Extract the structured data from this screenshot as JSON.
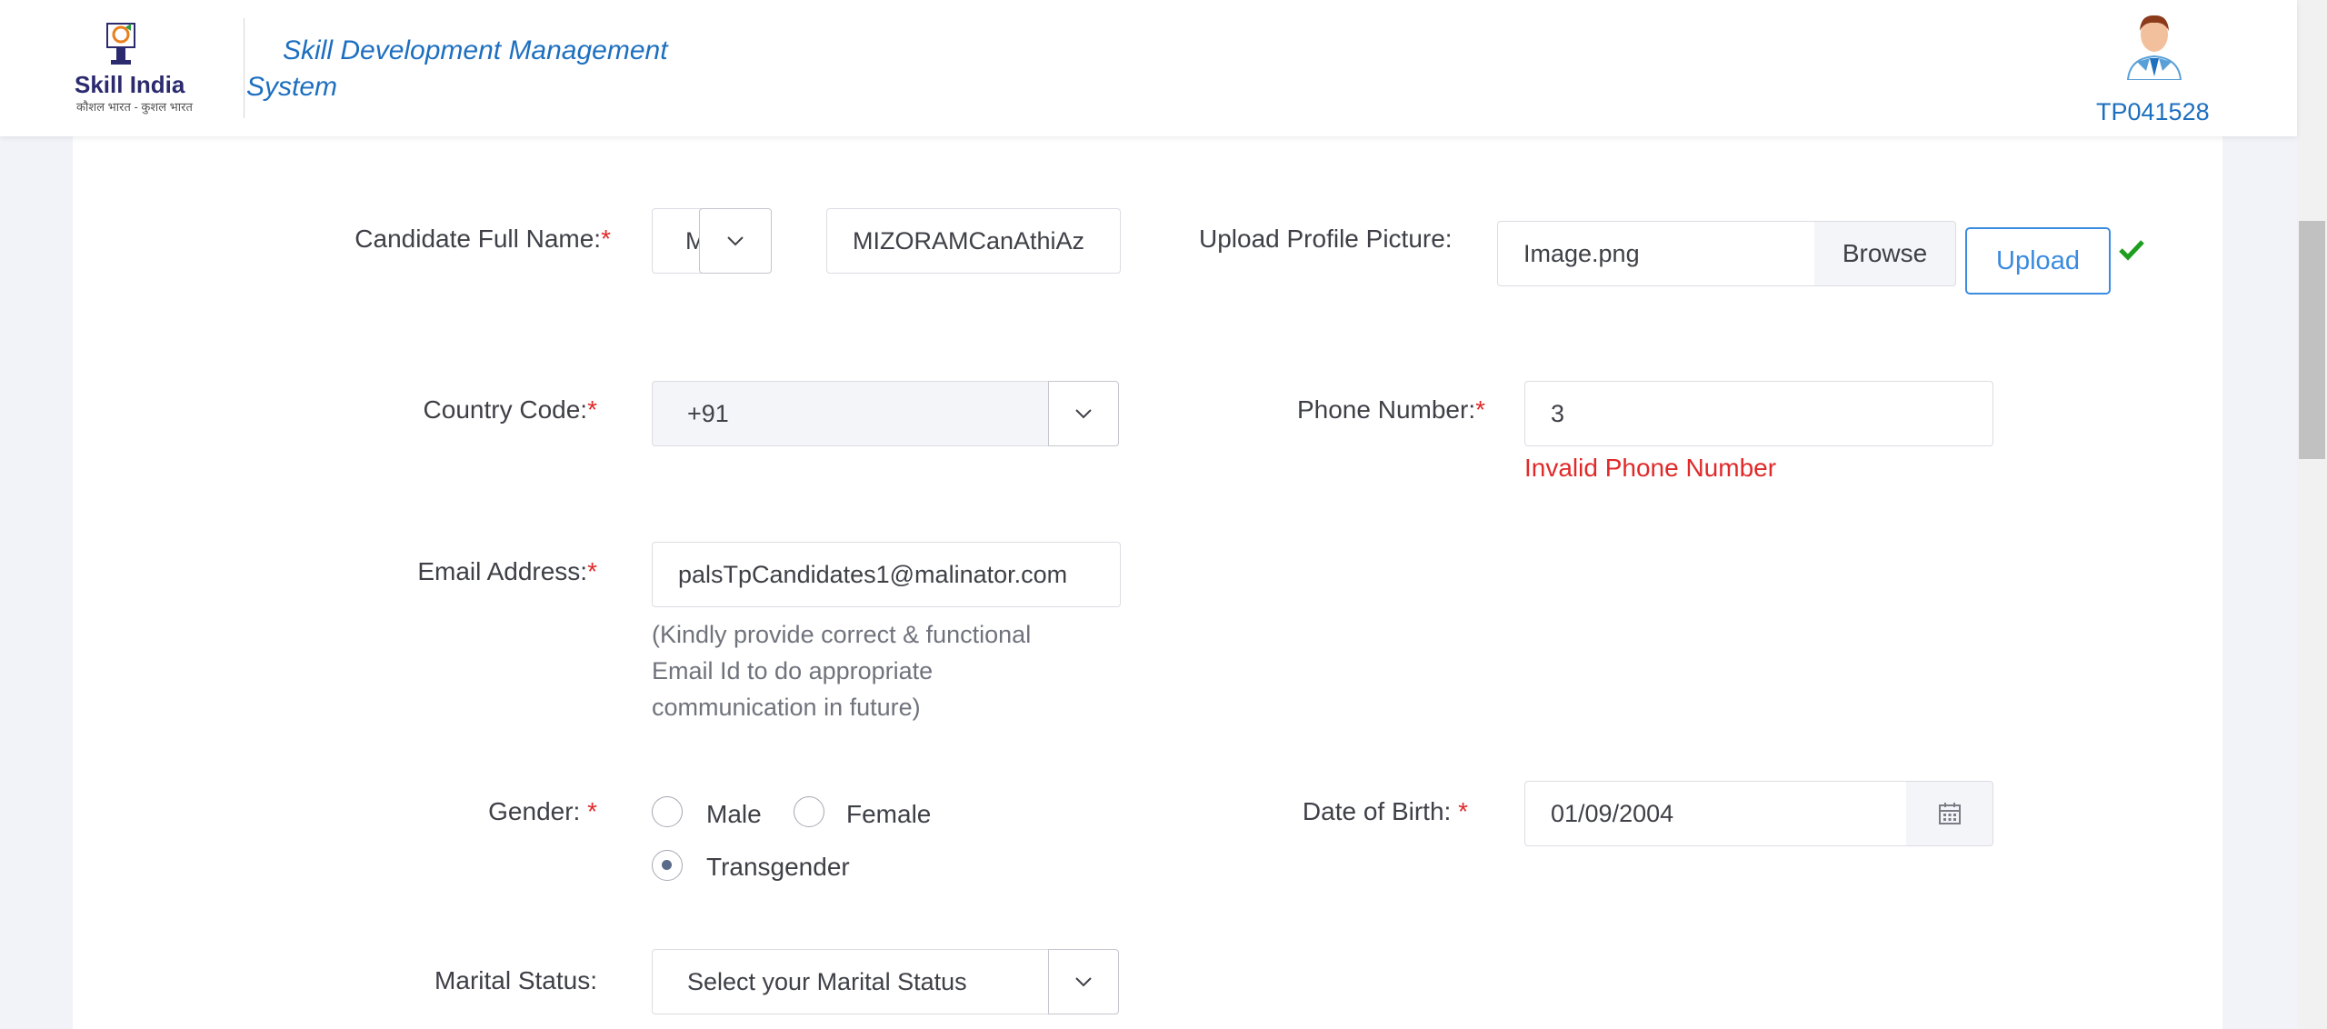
{
  "header": {
    "logo_text": "Skill India",
    "logo_subtext": "कौशल भारत - कुशल भारत",
    "app_title_line1": "Skill Development Management",
    "app_title_line2": "System",
    "user_id": "TP041528"
  },
  "form": {
    "candidate_name": {
      "label": "Candidate Full Name:",
      "required_mark": "*",
      "salutation_value": "M",
      "name_value": "MIZORAMCanAthiAz"
    },
    "profile_picture": {
      "label": "Upload Profile Picture:",
      "file_name": "Image.png",
      "browse_label": "Browse",
      "upload_label": "Upload",
      "status_icon": "checkmark-icon"
    },
    "country_code": {
      "label": "Country Code:",
      "required_mark": "*",
      "value": "+91"
    },
    "phone": {
      "label": "Phone Number:",
      "required_mark": "*",
      "value": "3",
      "error": "Invalid Phone Number"
    },
    "email": {
      "label": "Email Address:",
      "required_mark": "*",
      "value": "palsTpCandidates1@malinator.com",
      "help_line1": "(Kindly provide correct & functional",
      "help_line2": "Email Id to do appropriate",
      "help_line3": "communication in future)"
    },
    "gender": {
      "label": "Gender: ",
      "required_mark": "*",
      "options": [
        "Male",
        "Female",
        "Transgender"
      ],
      "selected": "Transgender"
    },
    "dob": {
      "label": "Date of Birth: ",
      "required_mark": "*",
      "value": "01/09/2004"
    },
    "marital_status": {
      "label": "Marital Status:",
      "placeholder": "Select your Marital Status"
    }
  },
  "colors": {
    "accent": "#1d6fbf",
    "required": "#e02a2a",
    "success": "#1e9e1e",
    "upload_button": "#3b8be0"
  }
}
